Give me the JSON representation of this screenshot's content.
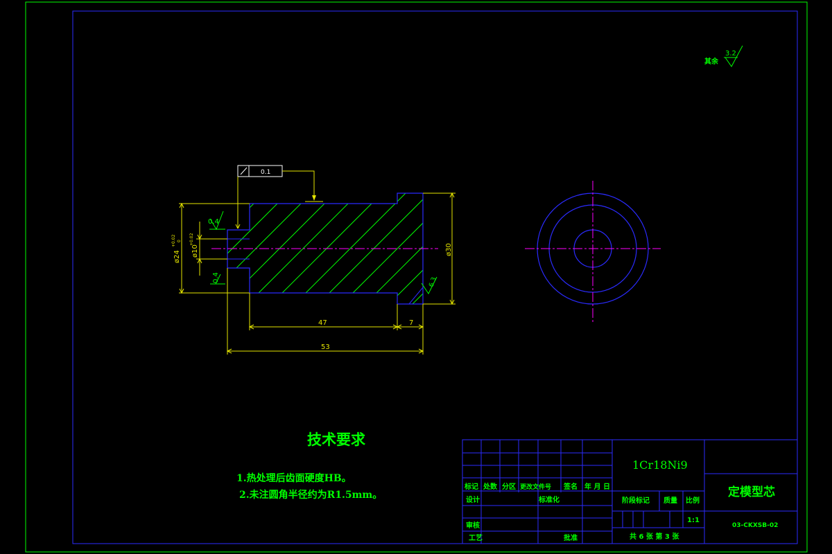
{
  "roughness": {
    "value": "3.2",
    "prefix": "其余"
  },
  "tolerance_frame": {
    "value": "0.1"
  },
  "surface_marks": {
    "top_left": "0.4",
    "bottom_left": "0.4",
    "right_chamfer": "6.3"
  },
  "dimensions": {
    "d24": "ø24",
    "d24_tol_upper": "+0.02",
    "d24_tol_lower": "0",
    "d10": "ø10",
    "d10_tol": "+0.02",
    "d30": "ø30",
    "len47": "47",
    "len7": "7",
    "len53": "53"
  },
  "tech_requirements": {
    "title": "技术要求",
    "items": [
      "1.热处理后齿面硬度HB。",
      "2.未注圆角半径约为R1.5mm。"
    ]
  },
  "title_block": {
    "material": "1Cr18Ni9",
    "part_name": "定模型芯",
    "drawing_no": "03-CKXSB-02",
    "scale_label": "比例",
    "scale_value": "1:1",
    "stage_label": "阶段标记",
    "weight_label": "质量",
    "sheet_info": "共 6 张 第 3 张",
    "row_headers": [
      "标记",
      "处数",
      "分区",
      "更改文件号",
      "签名",
      "年 月 日"
    ],
    "design": "设计",
    "standardization": "标准化",
    "review": "审核",
    "process": "工艺",
    "approve": "批准"
  }
}
